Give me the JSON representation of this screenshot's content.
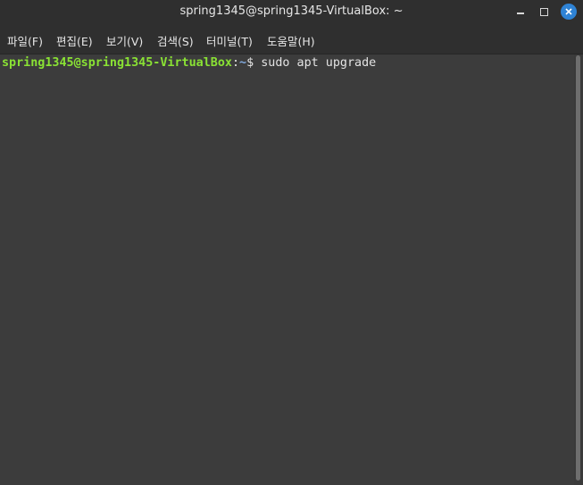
{
  "window": {
    "title": "spring1345@spring1345-VirtualBox: ~"
  },
  "menu": {
    "items": [
      {
        "label": "파일(F)"
      },
      {
        "label": "편집(E)"
      },
      {
        "label": "보기(V)"
      },
      {
        "label": "검색(S)"
      },
      {
        "label": "터미널(T)"
      },
      {
        "label": "도움말(H)"
      }
    ]
  },
  "terminal": {
    "prompt_user": "spring1345@spring1345-VirtualBox",
    "prompt_sep": ":",
    "prompt_path": "~",
    "prompt_symbol": "$ ",
    "command": "sudo apt upgrade"
  },
  "colors": {
    "prompt_user": "#8ae234",
    "prompt_path": "#82aadf",
    "close_button": "#2f83d5",
    "background": "#3c3c3c"
  },
  "icons": {
    "minimize": "minimize-icon",
    "maximize": "maximize-icon",
    "close": "close-icon"
  }
}
